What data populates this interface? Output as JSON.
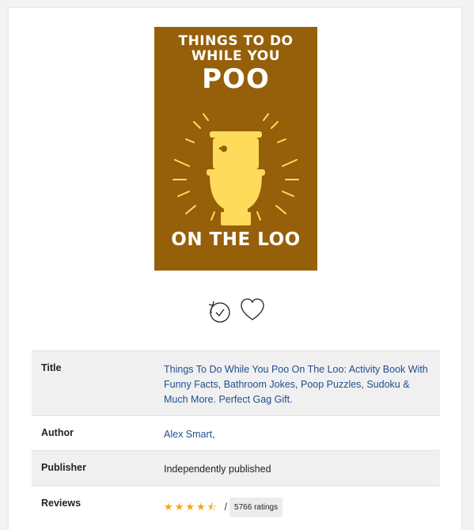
{
  "book": {
    "cover": {
      "line1": "THINGS TO DO",
      "line2": "WHILE YOU",
      "line3": "POO",
      "line4": "ON THE LOO",
      "background_color": "#965f0a",
      "art_color": "#fedb5a",
      "art": "toilet-illustration"
    },
    "actions": {
      "history_icon": "history-icon",
      "favorite_icon": "heart-icon"
    },
    "details": {
      "title_label": "Title",
      "title_value": "Things To Do While You Poo On The Loo: Activity Book With Funny Facts, Bathroom Jokes, Poop Puzzles, Sudoku & Much More. Perfect Gag Gift.",
      "author_label": "Author",
      "author_value": "Alex Smart,",
      "publisher_label": "Publisher",
      "publisher_value": "Independently published",
      "reviews_label": "Reviews",
      "rating_stars": 4.5,
      "rating_separator": "/",
      "ratings_count": "5766 ratings",
      "star_color": "#f3a51b",
      "link_color": "#1f4f8f"
    }
  }
}
